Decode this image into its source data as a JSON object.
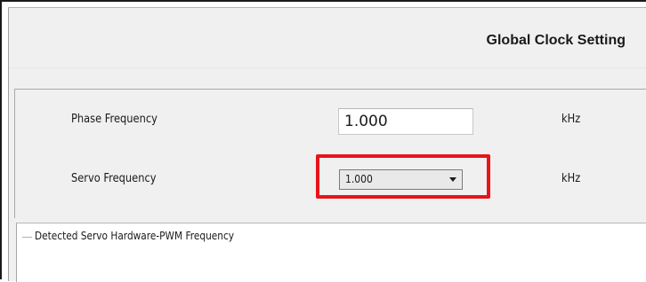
{
  "header": {
    "title": "Global Clock Setting"
  },
  "phase_frequency": {
    "label": "Phase Frequency",
    "value": "1.000",
    "unit": "kHz"
  },
  "servo_frequency": {
    "label": "Servo Frequency",
    "selected_value": "1.000",
    "unit": "kHz",
    "highlight_color": "#e8141b"
  },
  "hardware_pwm_group": {
    "title": "Detected Servo Hardware-PWM Frequency"
  }
}
